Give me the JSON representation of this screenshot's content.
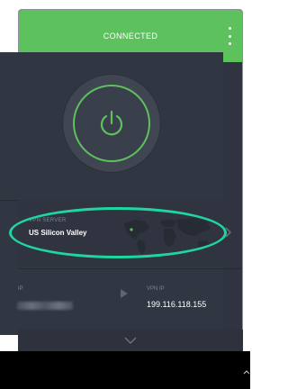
{
  "header": {
    "status": "CONNECTED",
    "accent_color": "#5dc15d"
  },
  "power": {
    "icon": "power-icon",
    "state_color": "#5dc15d"
  },
  "server": {
    "label": "VPN SERVER",
    "value": "US Silicon Valley",
    "map_icon": "world-map",
    "chevron_icon": "chevron-right-icon"
  },
  "connection": {
    "ip_label": "IP",
    "vpn_ip_label": "VPN IP",
    "vpn_ip_value": "199.116.118.155",
    "arrow_icon": "arrow-right-icon"
  },
  "footer": {
    "expand_icon": "chevron-down-icon"
  },
  "highlight_color": "#1ed6a1"
}
